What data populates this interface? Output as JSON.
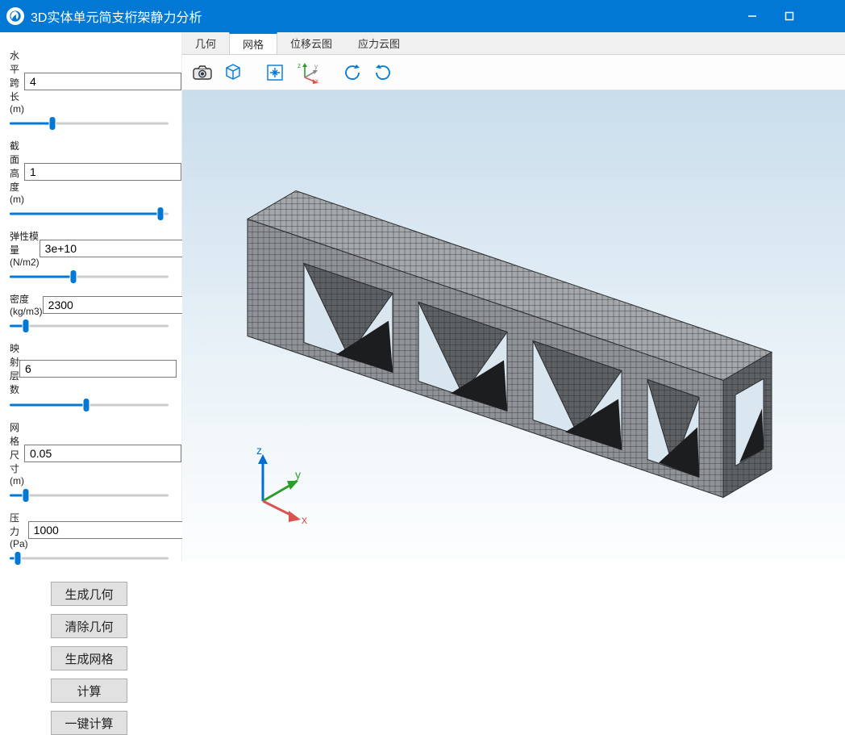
{
  "window": {
    "title": "3D实体单元简支桁架静力分析"
  },
  "params": [
    {
      "label": "水平跨长(m)",
      "value": "4",
      "slider_pct": 27
    },
    {
      "label": "截面高度(m)",
      "value": "1",
      "slider_pct": 95
    },
    {
      "label": "弹性模量(N/m2)",
      "value": "3e+10",
      "slider_pct": 40,
      "label_wide": true
    },
    {
      "label": "密度(kg/m3)",
      "value": "2300",
      "slider_pct": 10,
      "label_wide": true
    },
    {
      "label": "映射层数",
      "value": "6",
      "slider_pct": 48
    },
    {
      "label": "网格尺寸(m)",
      "value": "0.05",
      "slider_pct": 10
    },
    {
      "label": "压力(Pa)",
      "value": "1000",
      "slider_pct": 5
    }
  ],
  "buttons": {
    "gen_geom": "生成几何",
    "clear_geom": "清除几何",
    "gen_mesh": "生成网格",
    "calc": "计算",
    "one_click": "一键计算"
  },
  "tabs": [
    {
      "label": "几何",
      "active": false
    },
    {
      "label": "网格",
      "active": true
    },
    {
      "label": "位移云图",
      "active": false
    },
    {
      "label": "应力云图",
      "active": false
    }
  ],
  "toolbar_icons": [
    "camera-icon",
    "view-cube-icon",
    "fit-icon",
    "axis-icon",
    "rotate-left-icon",
    "rotate-right-icon"
  ],
  "axis_labels": {
    "x": "x",
    "y": "y",
    "z": "z"
  }
}
